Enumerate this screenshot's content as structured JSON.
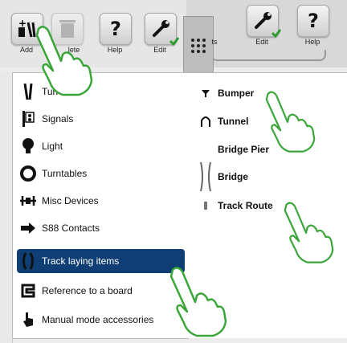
{
  "toolbar_left": {
    "add_label": "Add",
    "delete_label": "lete",
    "help_label": "Help",
    "edit_label": "Edit"
  },
  "toolbar_right": {
    "partial_label": "ts",
    "edit_label": "Edit",
    "help_label": "Help"
  },
  "menu_left": {
    "items": [
      {
        "label": "Turnouts",
        "icon": "turnout-icon"
      },
      {
        "label": "Signals",
        "icon": "signal-icon"
      },
      {
        "label": "Light",
        "icon": "bulb-icon"
      },
      {
        "label": "Turntables",
        "icon": "turntable-icon"
      },
      {
        "label": "Misc Devices",
        "icon": "misc-device-icon"
      },
      {
        "label": "S88 Contacts",
        "icon": "contact-arrow-icon"
      },
      {
        "label": "Track laying items",
        "icon": "track-laying-icon",
        "selected": true
      },
      {
        "label": "Reference to a board",
        "icon": "board-reference-icon"
      },
      {
        "label": "Manual mode accessories",
        "icon": "hand-pointer-icon"
      }
    ]
  },
  "menu_right": {
    "items": [
      {
        "label": "Bumper",
        "icon": "bumper-icon"
      },
      {
        "label": "Tunnel",
        "icon": "tunnel-icon"
      },
      {
        "label": "Bridge Pier",
        "icon": "bridge-pier-icon"
      },
      {
        "label": "Bridge",
        "icon": "bridge-icon"
      },
      {
        "label": "Track Route",
        "icon": "track-route-icon"
      }
    ]
  },
  "colors": {
    "selection": "#0e3e73",
    "hand_outline": "#3aa63a",
    "hand_fill": "#ffffff",
    "check": "#2e9b2e"
  }
}
